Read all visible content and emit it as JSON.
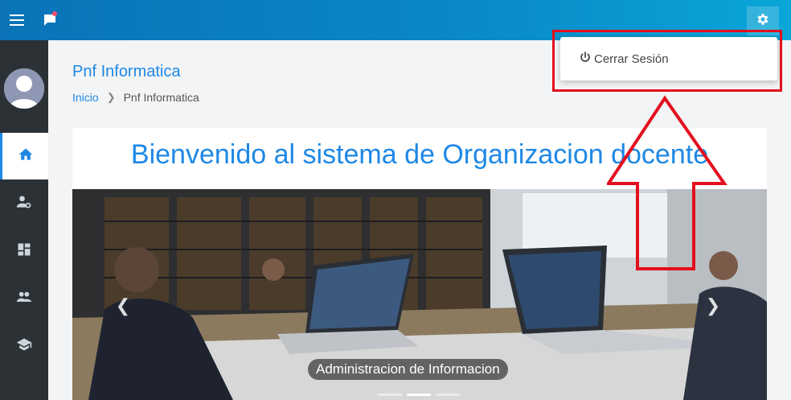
{
  "topbar": {
    "menu_icon": "hamburger-menu-icon",
    "chat_icon": "chat-icon",
    "settings_icon": "gear-icon",
    "accent": "#0a86c6"
  },
  "sidebar": {
    "items": [
      {
        "icon": "home-icon",
        "active": true
      },
      {
        "icon": "user-settings-icon",
        "active": false
      },
      {
        "icon": "dashboard-icon",
        "active": false
      },
      {
        "icon": "people-icon",
        "active": false
      },
      {
        "icon": "graduation-cap-icon",
        "active": false
      }
    ]
  },
  "page": {
    "title": "Pnf Informatica",
    "breadcrumb": {
      "home": "Inicio",
      "current": "Pnf Informatica"
    }
  },
  "card": {
    "welcome": "Bienvenido al sistema de Organizacion docente"
  },
  "carousel": {
    "caption": "Administracion de Informacion",
    "slide_count": 3,
    "active_slide": 2
  },
  "dropdown": {
    "logout_label": "Cerrar Sesión",
    "logout_icon": "power-icon"
  },
  "annotation": {
    "color": "#e3101e"
  }
}
